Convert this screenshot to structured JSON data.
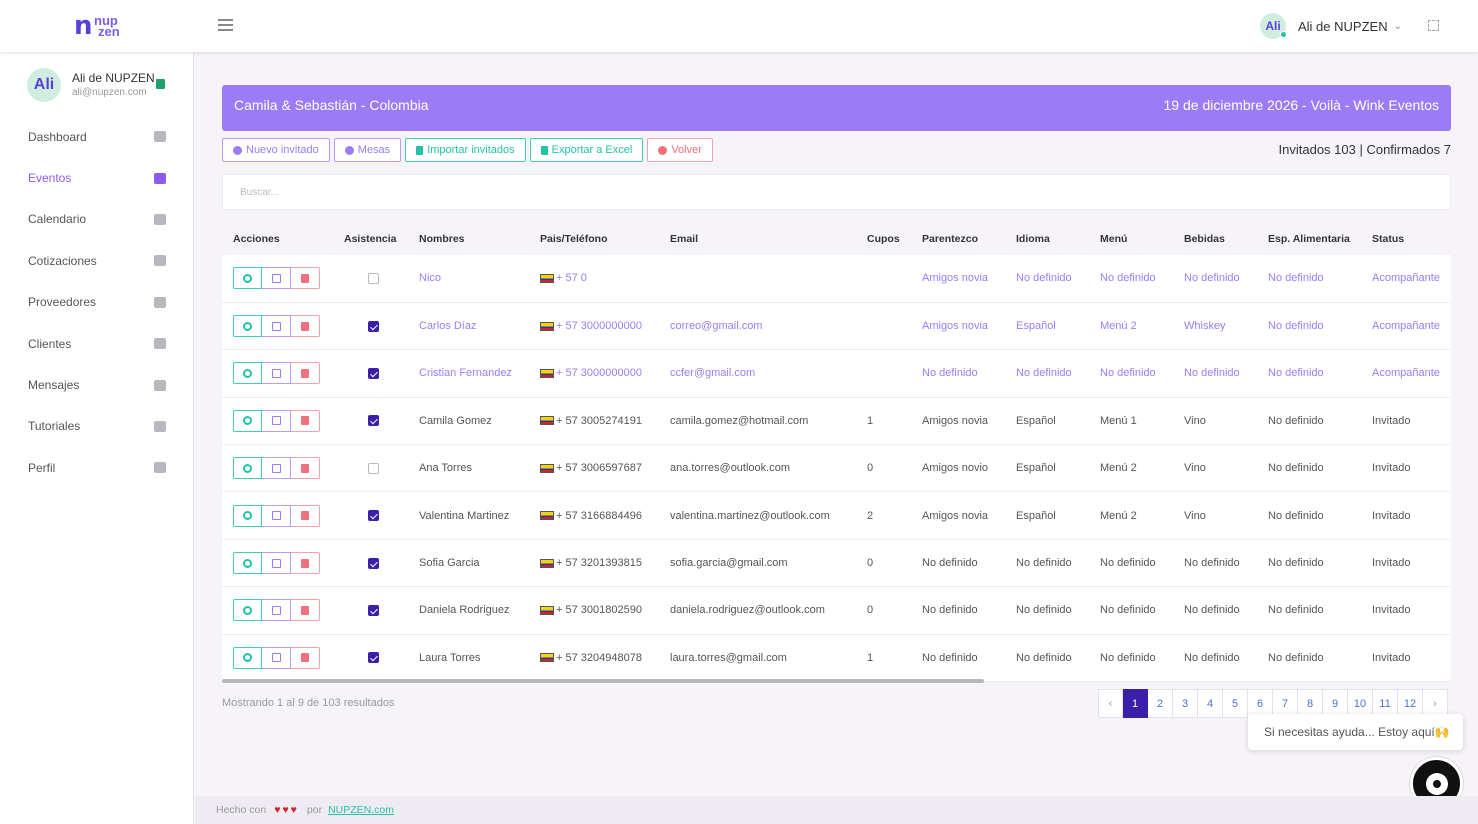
{
  "brand": {
    "logo_n": "n",
    "logo_top": "nup",
    "logo_bottom": "zen"
  },
  "topbar": {
    "user_name": "Ali de NUPZEN",
    "avatar_text": "Ali"
  },
  "profile": {
    "name": "Ali de NUPZEN",
    "email": "ali@nupzen.com",
    "avatar_text": "Ali"
  },
  "sidebar": {
    "items": [
      {
        "label": "Dashboard",
        "icon": "dashboard-icon"
      },
      {
        "label": "Eventos",
        "icon": "cake-icon",
        "active": true
      },
      {
        "label": "Calendario",
        "icon": "calendar-icon"
      },
      {
        "label": "Cotizaciones",
        "icon": "chart-icon"
      },
      {
        "label": "Proveedores",
        "icon": "truck-icon"
      },
      {
        "label": "Clientes",
        "icon": "users-icon"
      },
      {
        "label": "Mensajes",
        "icon": "message-icon"
      },
      {
        "label": "Tutoriales",
        "icon": "video-icon"
      },
      {
        "label": "Perfil",
        "icon": "user-icon"
      }
    ]
  },
  "banner": {
    "left": "Camila & Sebastián - Colombia",
    "right": "19 de diciembre 2026 - Voilà - Wink Eventos"
  },
  "toolbar": {
    "nuevo": "Nuevo invitado",
    "mesas": "Mesas",
    "importar": "Importar invitados",
    "exportar": "Exportar a Excel",
    "volver": "Volver"
  },
  "counts": "Invitados 103 | Confirmados 7",
  "search": {
    "placeholder": "Buscar..."
  },
  "table": {
    "headers": [
      "Acciones",
      "Asistencia",
      "Nombres",
      "Pais/Teléfono",
      "Email",
      "Cupos",
      "Parentezco",
      "Idioma",
      "Menú",
      "Bebidas",
      "Esp. Alimentaria",
      "Status"
    ],
    "rows": [
      {
        "checked": false,
        "link": true,
        "name": "Nico",
        "phone": "+ 57 0",
        "email": "",
        "cupos": "",
        "parentezco": "Amigos novia",
        "idioma": "No definido",
        "menu": "No definido",
        "bebidas": "No definido",
        "esp": "No definido",
        "status": "Acompañante"
      },
      {
        "checked": true,
        "link": true,
        "name": "Carlos Díaz",
        "phone": "+ 57 3000000000",
        "email": "correo@gmail.com",
        "cupos": "",
        "parentezco": "Amigos novia",
        "idioma": "Español",
        "menu": "Menú 2",
        "bebidas": "Whiskey",
        "esp": "No definido",
        "status": "Acompañante"
      },
      {
        "checked": true,
        "link": true,
        "name": "Cristian Fernandez",
        "phone": "+ 57 3000000000",
        "email": "ccfer@gmail.com",
        "cupos": "",
        "parentezco": "No definido",
        "idioma": "No definido",
        "menu": "No definido",
        "bebidas": "No definido",
        "esp": "No definido",
        "status": "Acompañante"
      },
      {
        "checked": true,
        "link": false,
        "name": "Camila Gomez",
        "phone": "+ 57 3005274191",
        "email": "camila.gomez@hotmail.com",
        "cupos": "1",
        "parentezco": "Amigos novia",
        "idioma": "Español",
        "menu": "Menú 1",
        "bebidas": "Vino",
        "esp": "No definido",
        "status": "Invitado"
      },
      {
        "checked": false,
        "link": false,
        "name": "Ana Torres",
        "phone": "+ 57 3006597687",
        "email": "ana.torres@outlook.com",
        "cupos": "0",
        "parentezco": "Amigos novio",
        "idioma": "Español",
        "menu": "Menú 2",
        "bebidas": "Vino",
        "esp": "No definido",
        "status": "Invitado"
      },
      {
        "checked": true,
        "link": false,
        "name": "Valentina Martinez",
        "phone": "+ 57 3166884496",
        "email": "valentina.martinez@outlook.com",
        "cupos": "2",
        "parentezco": "Amigos novia",
        "idioma": "Español",
        "menu": "Menú 2",
        "bebidas": "Vino",
        "esp": "No definido",
        "status": "Invitado"
      },
      {
        "checked": true,
        "link": false,
        "name": "Sofia Garcia",
        "phone": "+ 57 3201393815",
        "email": "sofia.garcia@gmail.com",
        "cupos": "0",
        "parentezco": "No definido",
        "idioma": "No definido",
        "menu": "No definido",
        "bebidas": "No definido",
        "esp": "No definido",
        "status": "Invitado"
      },
      {
        "checked": true,
        "link": false,
        "name": "Daniela Rodriguez",
        "phone": "+ 57 3001802590",
        "email": "daniela.rodriguez@outlook.com",
        "cupos": "0",
        "parentezco": "No definido",
        "idioma": "No definido",
        "menu": "No definido",
        "bebidas": "No definido",
        "esp": "No definido",
        "status": "Invitado"
      },
      {
        "checked": true,
        "link": false,
        "name": "Laura Torres",
        "phone": "+ 57 3204948078",
        "email": "laura.torres@gmail.com",
        "cupos": "1",
        "parentezco": "No definido",
        "idioma": "No definido",
        "menu": "No definido",
        "bebidas": "No definido",
        "esp": "No definido",
        "status": "Invitado"
      }
    ]
  },
  "showing": "Mostrando 1 al 9 de 103 resultados",
  "pagination": {
    "prev": "‹",
    "next": "›",
    "pages": [
      "1",
      "2",
      "3",
      "4",
      "5",
      "6",
      "7",
      "8",
      "9",
      "10",
      "11",
      "12"
    ],
    "current": "1"
  },
  "help": {
    "text": "Si necesitas ayuda... Estoy aquí🙌"
  },
  "footer": {
    "prefix": "Hecho con",
    "hearts": "♥♥♥",
    "by": "por",
    "link": "NUPZEN.com"
  },
  "colors": {
    "accent": "#9b7cf6",
    "dark_accent": "#3b1fa8",
    "teal": "#22c3a6",
    "red": "#f0707f"
  }
}
